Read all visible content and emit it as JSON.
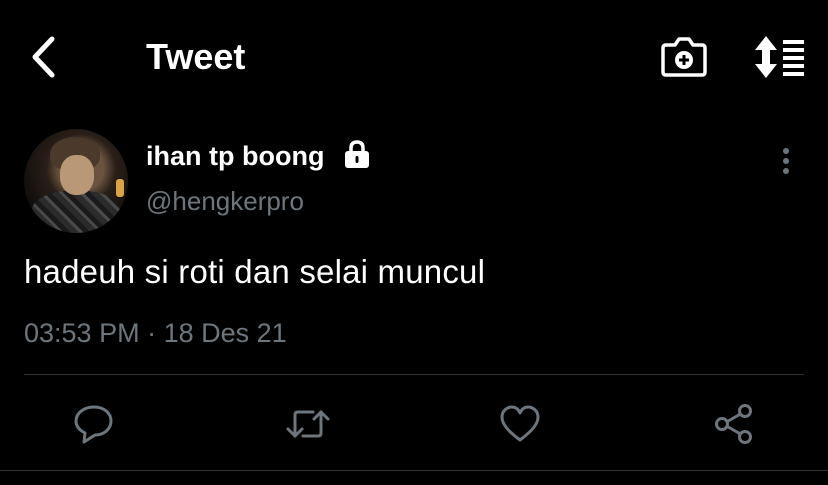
{
  "header": {
    "title": "Tweet",
    "back_icon": "chevron-left-icon",
    "camera_icon": "camera-plus-icon",
    "sort_icon": "sort-list-icon"
  },
  "tweet": {
    "display_name": "ihan tp boong",
    "protected_icon": "lock-icon",
    "handle": "@hengkerpro",
    "text": "hadeuh si roti dan selai muncul",
    "time": "03:53 PM",
    "separator": "·",
    "date": "18 Des 21",
    "more_icon": "more-vertical-icon"
  },
  "actions": {
    "reply_icon": "reply-icon",
    "retweet_icon": "retweet-icon",
    "like_icon": "heart-icon",
    "share_icon": "share-icon"
  },
  "colors": {
    "background": "#000000",
    "text_primary": "#ffffff",
    "text_secondary": "#6e767d",
    "divider": "#2f3336",
    "icon_secondary": "#6e767d"
  }
}
